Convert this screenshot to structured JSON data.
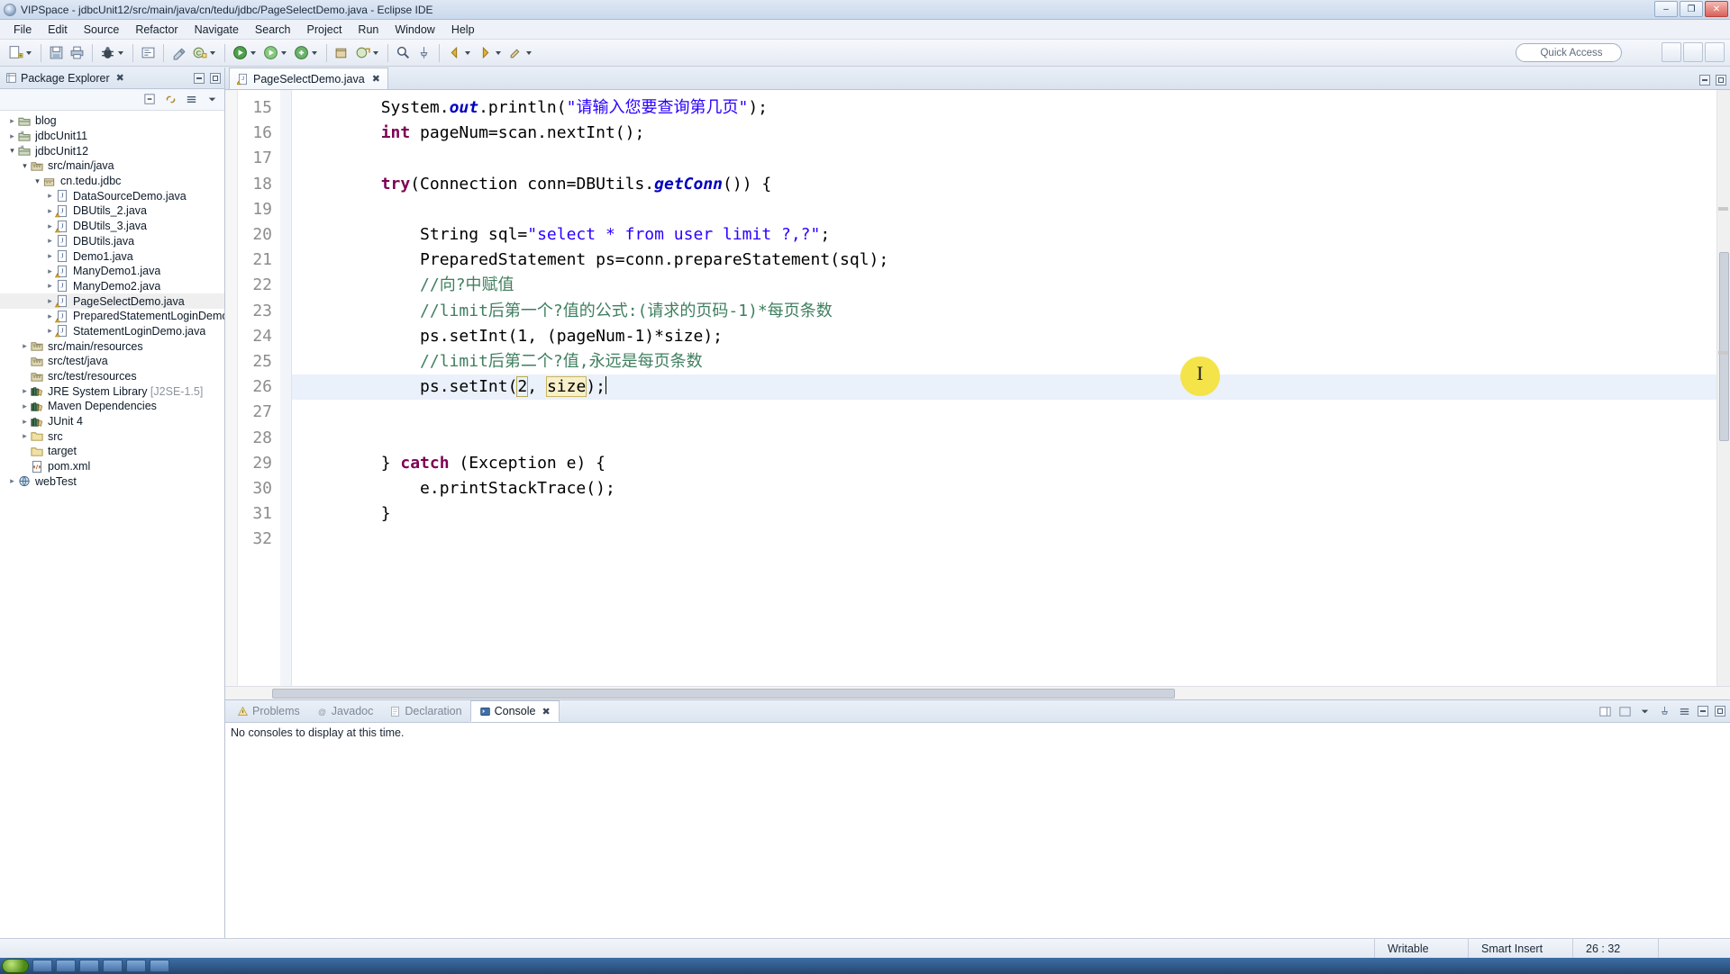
{
  "window": {
    "title": "VIPSpace - jdbcUnit12/src/main/java/cn/tedu/jdbc/PageSelectDemo.java - Eclipse IDE",
    "icon": "eclipse-icon",
    "minimize_label": "–",
    "maximize_label": "❐",
    "close_label": "✕"
  },
  "menu": {
    "items": [
      {
        "label": "File"
      },
      {
        "label": "Edit"
      },
      {
        "label": "Source"
      },
      {
        "label": "Refactor"
      },
      {
        "label": "Navigate"
      },
      {
        "label": "Search"
      },
      {
        "label": "Project"
      },
      {
        "label": "Run"
      },
      {
        "label": "Window"
      },
      {
        "label": "Help"
      }
    ]
  },
  "toolbar": {
    "quick_access": "Quick Access",
    "search_icon": "search-icon"
  },
  "explorer": {
    "tab_label": "Package Explorer",
    "close_label": "✖",
    "collapse_all_icon": "collapse-all-icon",
    "link_editor_icon": "link-with-editor-icon",
    "view_menu_icon": "view-menu-icon",
    "minimize_icon": "minimize-icon",
    "maximize_icon": "maximize-icon",
    "tree": [
      {
        "label": "blog",
        "indent": 0,
        "arrow": "collapsed",
        "icon": "project-icon"
      },
      {
        "label": "jdbcUnit11",
        "indent": 0,
        "arrow": "collapsed",
        "icon": "maven-project-icon"
      },
      {
        "label": "jdbcUnit12",
        "indent": 0,
        "arrow": "expanded",
        "icon": "maven-project-icon"
      },
      {
        "label": "src/main/java",
        "indent": 1,
        "arrow": "expanded",
        "icon": "source-folder-icon"
      },
      {
        "label": "cn.tedu.jdbc",
        "indent": 2,
        "arrow": "expanded",
        "icon": "package-icon"
      },
      {
        "label": "DataSourceDemo.java",
        "indent": 3,
        "arrow": "collapsed",
        "icon": "java-file-icon"
      },
      {
        "label": "DBUtils_2.java",
        "indent": 3,
        "arrow": "collapsed",
        "icon": "java-file-warn-icon"
      },
      {
        "label": "DBUtils_3.java",
        "indent": 3,
        "arrow": "collapsed",
        "icon": "java-file-warn-icon"
      },
      {
        "label": "DBUtils.java",
        "indent": 3,
        "arrow": "collapsed",
        "icon": "java-file-icon"
      },
      {
        "label": "Demo1.java",
        "indent": 3,
        "arrow": "collapsed",
        "icon": "java-file-icon"
      },
      {
        "label": "ManyDemo1.java",
        "indent": 3,
        "arrow": "collapsed",
        "icon": "java-file-warn-icon"
      },
      {
        "label": "ManyDemo2.java",
        "indent": 3,
        "arrow": "collapsed",
        "icon": "java-file-icon"
      },
      {
        "label": "PageSelectDemo.java",
        "indent": 3,
        "arrow": "collapsed",
        "icon": "java-file-warn-icon",
        "selected": true
      },
      {
        "label": "PreparedStatementLoginDemo.java",
        "indent": 3,
        "arrow": "collapsed",
        "icon": "java-file-warn-icon"
      },
      {
        "label": "StatementLoginDemo.java",
        "indent": 3,
        "arrow": "collapsed",
        "icon": "java-file-warn-icon"
      },
      {
        "label": "src/main/resources",
        "indent": 1,
        "arrow": "collapsed",
        "icon": "source-folder-icon"
      },
      {
        "label": "src/test/java",
        "indent": 1,
        "arrow": "none",
        "icon": "source-folder-icon"
      },
      {
        "label": "src/test/resources",
        "indent": 1,
        "arrow": "none",
        "icon": "source-folder-icon"
      },
      {
        "label": "JRE System Library",
        "suffix": "[J2SE-1.5]",
        "indent": 1,
        "arrow": "collapsed",
        "icon": "library-icon"
      },
      {
        "label": "Maven Dependencies",
        "indent": 1,
        "arrow": "collapsed",
        "icon": "library-icon"
      },
      {
        "label": "JUnit 4",
        "indent": 1,
        "arrow": "collapsed",
        "icon": "library-icon"
      },
      {
        "label": "src",
        "indent": 1,
        "arrow": "collapsed",
        "icon": "folder-icon"
      },
      {
        "label": "target",
        "indent": 1,
        "arrow": "none",
        "icon": "folder-icon"
      },
      {
        "label": "pom.xml",
        "indent": 1,
        "arrow": "none",
        "icon": "xml-file-icon"
      },
      {
        "label": "webTest",
        "indent": 0,
        "arrow": "collapsed",
        "icon": "web-project-icon"
      }
    ]
  },
  "editor": {
    "tab": {
      "label": "PageSelectDemo.java",
      "icon": "java-file-warn-icon",
      "close_label": "✖"
    },
    "first_line": 15,
    "lines": [
      {
        "n": 15,
        "tokens": [
          {
            "t": "        System.",
            "c": "plain"
          },
          {
            "t": "out",
            "c": "fld"
          },
          {
            "t": ".println(",
            "c": "plain"
          },
          {
            "t": "\"请输入您要查询第几页\"",
            "c": "str"
          },
          {
            "t": ");",
            "c": "plain"
          }
        ]
      },
      {
        "n": 16,
        "tokens": [
          {
            "t": "        ",
            "c": "plain"
          },
          {
            "t": "int",
            "c": "kw"
          },
          {
            "t": " pageNum=scan.nextInt();",
            "c": "plain"
          }
        ]
      },
      {
        "n": 17,
        "tokens": [
          {
            "t": "",
            "c": "plain"
          }
        ]
      },
      {
        "n": 18,
        "tokens": [
          {
            "t": "        ",
            "c": "plain"
          },
          {
            "t": "try",
            "c": "kw"
          },
          {
            "t": "(Connection conn=DBUtils.",
            "c": "plain"
          },
          {
            "t": "getConn",
            "c": "fld"
          },
          {
            "t": "()) {",
            "c": "plain"
          }
        ]
      },
      {
        "n": 19,
        "tokens": [
          {
            "t": "",
            "c": "plain"
          }
        ]
      },
      {
        "n": 20,
        "tokens": [
          {
            "t": "            String sql=",
            "c": "plain"
          },
          {
            "t": "\"select * from user limit ?,?\"",
            "c": "str"
          },
          {
            "t": ";",
            "c": "plain"
          }
        ]
      },
      {
        "n": 21,
        "tokens": [
          {
            "t": "            PreparedStatement ps=conn.prepareStatement(sql);",
            "c": "plain"
          }
        ]
      },
      {
        "n": 22,
        "tokens": [
          {
            "t": "            //向?中赋值",
            "c": "cmt"
          }
        ]
      },
      {
        "n": 23,
        "tokens": [
          {
            "t": "            //limit后第一个?值的公式:(请求的页码-1)*每页条数",
            "c": "cmt"
          }
        ]
      },
      {
        "n": 24,
        "tokens": [
          {
            "t": "            ps.setInt(1, (pageNum-1)*size);",
            "c": "plain"
          }
        ]
      },
      {
        "n": 25,
        "tokens": [
          {
            "t": "            //limit后第二个?值,永远是每页条数",
            "c": "cmt"
          }
        ]
      },
      {
        "n": 26,
        "current": true,
        "tokens": [
          {
            "t": "            ps.setInt(",
            "c": "plain"
          },
          {
            "t": "2",
            "c": "caret"
          },
          {
            "t": ", ",
            "c": "plain"
          },
          {
            "t": "size",
            "c": "occ"
          },
          {
            "t": ");",
            "c": "plain"
          }
        ]
      },
      {
        "n": 27,
        "tokens": [
          {
            "t": "",
            "c": "plain"
          }
        ]
      },
      {
        "n": 28,
        "tokens": [
          {
            "t": "",
            "c": "plain"
          }
        ]
      },
      {
        "n": 29,
        "tokens": [
          {
            "t": "        } ",
            "c": "plain"
          },
          {
            "t": "catch",
            "c": "kw"
          },
          {
            "t": " (Exception e) {",
            "c": "plain"
          }
        ]
      },
      {
        "n": 30,
        "tokens": [
          {
            "t": "            e.printStackTrace();",
            "c": "plain"
          }
        ]
      },
      {
        "n": 31,
        "tokens": [
          {
            "t": "        }",
            "c": "plain"
          }
        ]
      },
      {
        "n": 32,
        "tokens": [
          {
            "t": "",
            "c": "plain"
          }
        ]
      }
    ],
    "cursor_overlay": "i-beam-cursor"
  },
  "console": {
    "tabs": [
      {
        "label": "Problems",
        "icon": "problems-icon",
        "active": false
      },
      {
        "label": "Javadoc",
        "icon": "javadoc-icon",
        "active": false
      },
      {
        "label": "Declaration",
        "icon": "declaration-icon",
        "active": false
      },
      {
        "label": "Console",
        "icon": "console-icon",
        "active": true,
        "close_label": "✖"
      }
    ],
    "message": "No consoles to display at this time."
  },
  "statusbar": {
    "writable": "Writable",
    "insert_mode": "Smart Insert",
    "position": "26 : 32"
  },
  "colors": {
    "keyword": "#7f0055",
    "string": "#2a00ff",
    "comment": "#3f7f5f",
    "field": "#0000c0",
    "highlight": "#f7f0c9",
    "selection": "#eaf1fb",
    "cursor_dot": "#f4e23a"
  }
}
